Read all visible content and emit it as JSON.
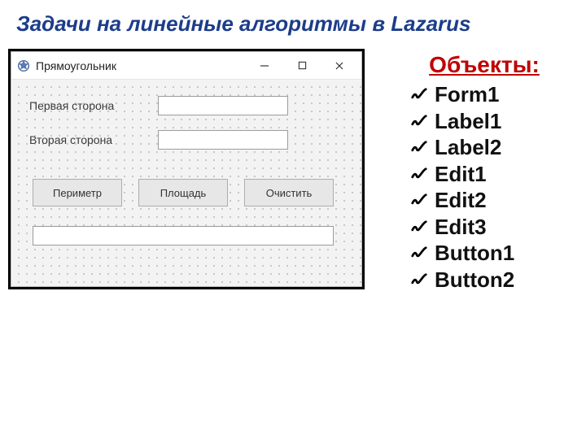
{
  "title": "Задачи на линейные алгоритмы в Lazarus",
  "window": {
    "title": "Прямоугольник",
    "labels": {
      "side1": "Первая сторона",
      "side2": "Вторая сторона"
    },
    "edits": {
      "e1": "",
      "e2": "",
      "e3": ""
    },
    "buttons": {
      "perimeter": "Периметр",
      "area": "Площадь",
      "clear": "Очистить"
    }
  },
  "sidebar": {
    "heading": "Объекты:",
    "items": [
      "Form1",
      "Label1",
      "Label2",
      "Edit1",
      "Edit2",
      "Edit3",
      "Button1",
      "Button2"
    ]
  }
}
